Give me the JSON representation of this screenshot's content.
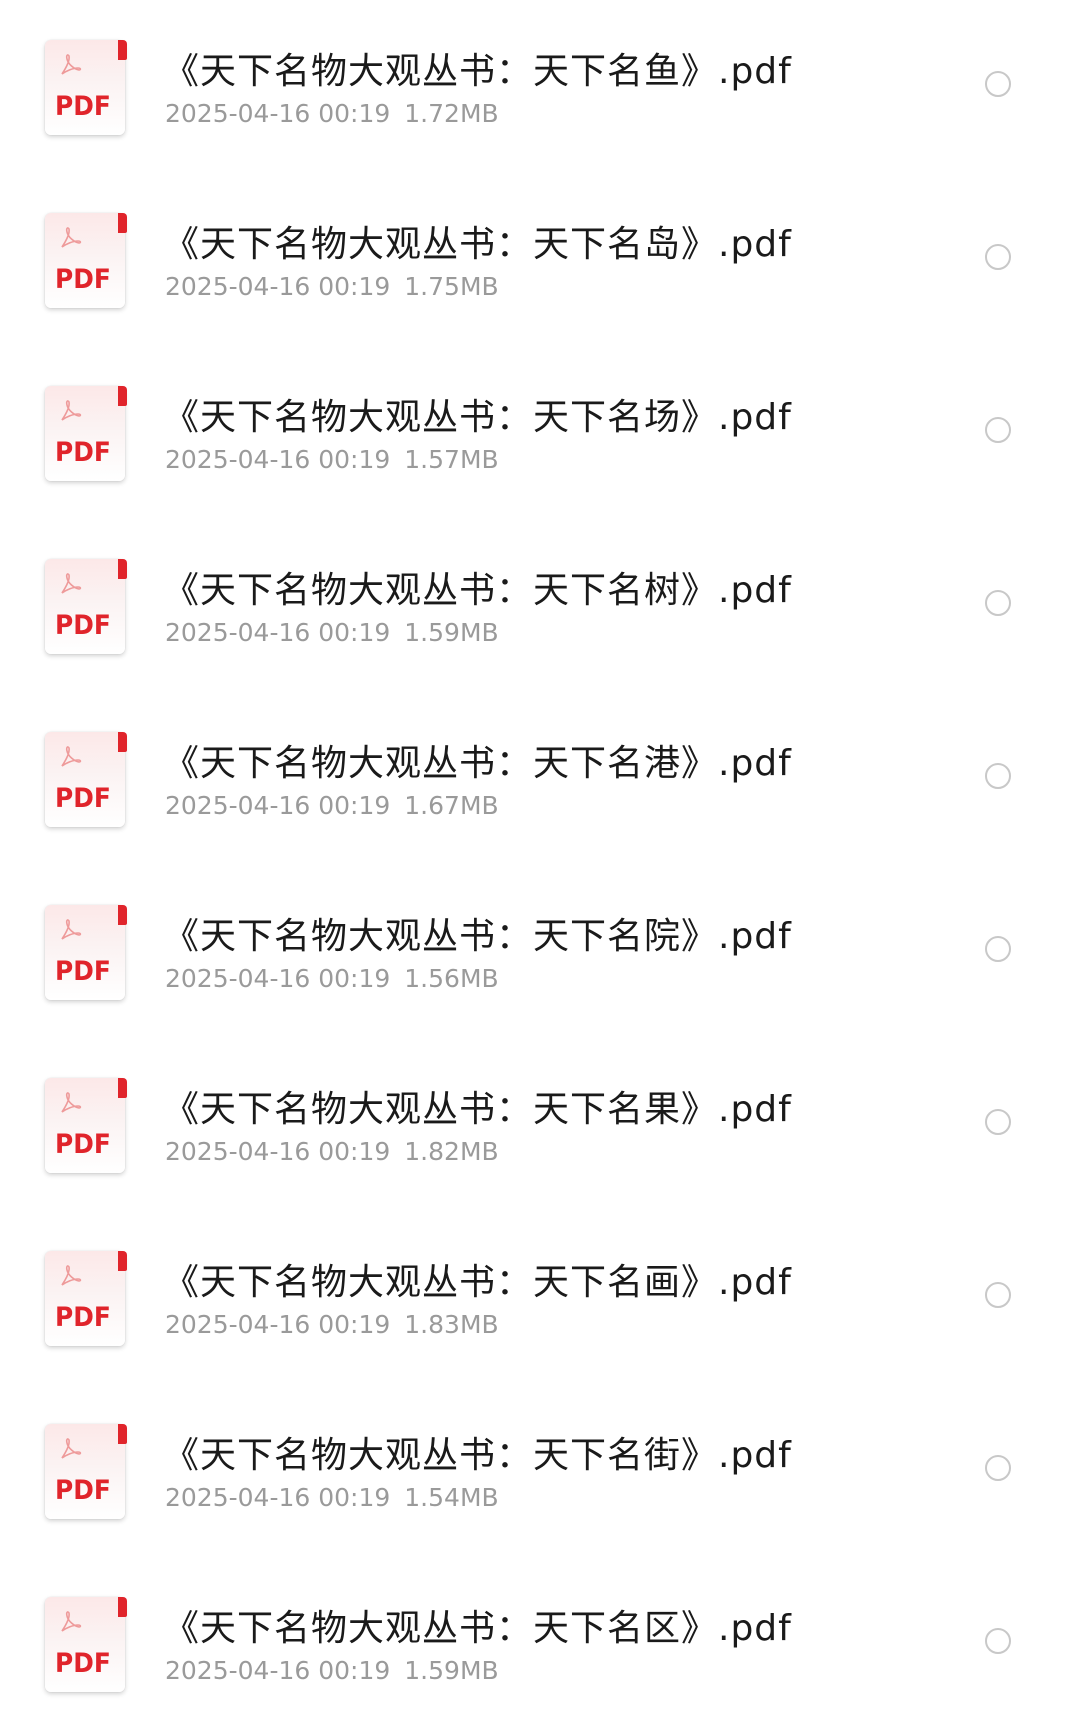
{
  "files": [
    {
      "name": "《天下名物大观丛书：天下名鱼》.pdf",
      "date": "2025-04-16 00:19",
      "size": "1.72MB",
      "icon": "pdf-icon",
      "icon_label": "PDF"
    },
    {
      "name": "《天下名物大观丛书：天下名岛》.pdf",
      "date": "2025-04-16 00:19",
      "size": "1.75MB",
      "icon": "pdf-icon",
      "icon_label": "PDF"
    },
    {
      "name": "《天下名物大观丛书：天下名场》.pdf",
      "date": "2025-04-16 00:19",
      "size": "1.57MB",
      "icon": "pdf-icon",
      "icon_label": "PDF"
    },
    {
      "name": "《天下名物大观丛书：天下名树》.pdf",
      "date": "2025-04-16 00:19",
      "size": "1.59MB",
      "icon": "pdf-icon",
      "icon_label": "PDF"
    },
    {
      "name": "《天下名物大观丛书：天下名港》.pdf",
      "date": "2025-04-16 00:19",
      "size": "1.67MB",
      "icon": "pdf-icon",
      "icon_label": "PDF"
    },
    {
      "name": "《天下名物大观丛书：天下名院》.pdf",
      "date": "2025-04-16 00:19",
      "size": "1.56MB",
      "icon": "pdf-icon",
      "icon_label": "PDF"
    },
    {
      "name": "《天下名物大观丛书：天下名果》.pdf",
      "date": "2025-04-16 00:19",
      "size": "1.82MB",
      "icon": "pdf-icon",
      "icon_label": "PDF"
    },
    {
      "name": "《天下名物大观丛书：天下名画》.pdf",
      "date": "2025-04-16 00:19",
      "size": "1.83MB",
      "icon": "pdf-icon",
      "icon_label": "PDF"
    },
    {
      "name": "《天下名物大观丛书：天下名街》.pdf",
      "date": "2025-04-16 00:19",
      "size": "1.54MB",
      "icon": "pdf-icon",
      "icon_label": "PDF"
    },
    {
      "name": "《天下名物大观丛书：天下名区》.pdf",
      "date": "2025-04-16 00:19",
      "size": "1.59MB",
      "icon": "pdf-icon",
      "icon_label": "PDF"
    }
  ],
  "colors": {
    "pdf_red": "#e0242b",
    "text_primary": "#1a1a1a",
    "text_secondary": "#9a9a9a",
    "radio_border": "#c8c8c8"
  }
}
